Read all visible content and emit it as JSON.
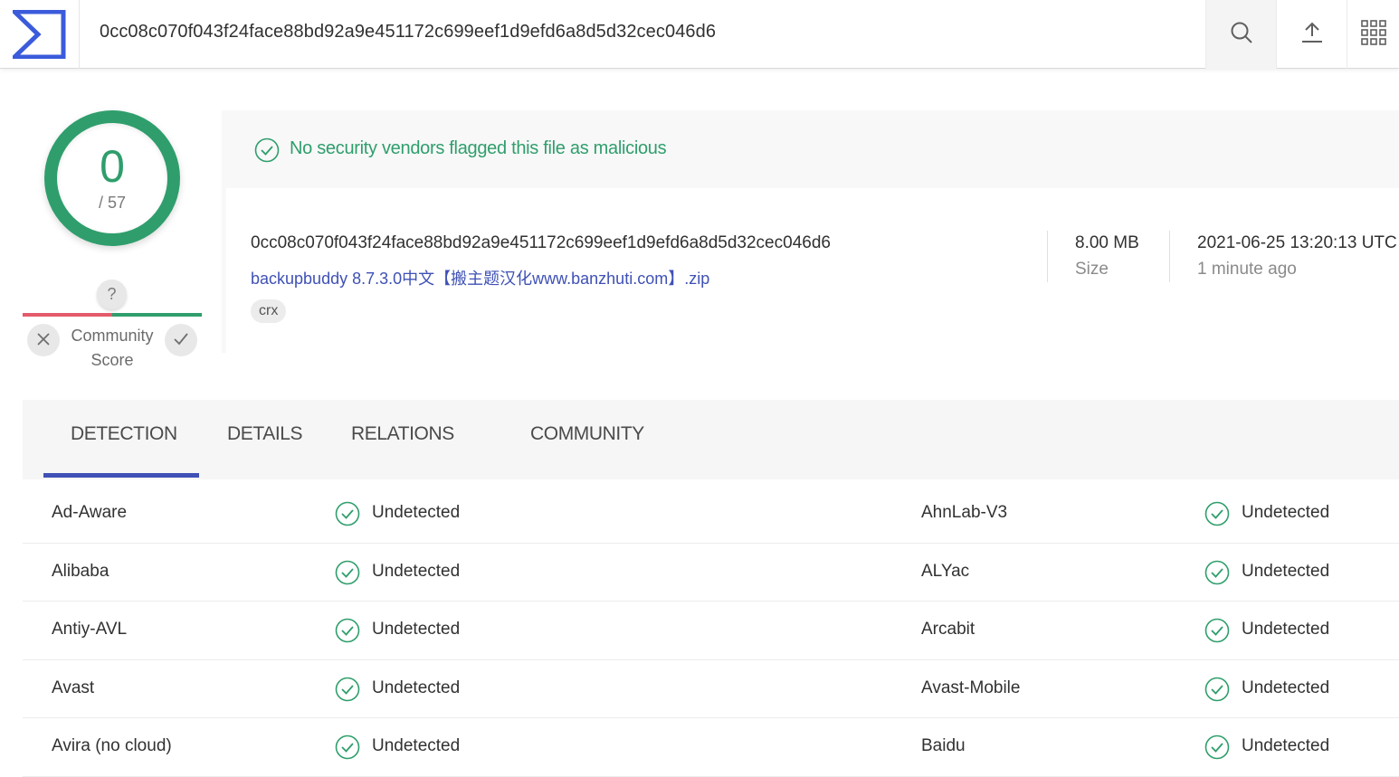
{
  "header": {
    "search_value": "0cc08c070f043f24face88bd92a9e451172c699eef1d9efd6a8d5d32cec046d6",
    "icons": [
      "logo-icon",
      "search-icon",
      "upload-icon",
      "apps-grid-icon"
    ]
  },
  "score": {
    "detections": "0",
    "total": "/ 57",
    "community_question": "?",
    "community_label": "Community Score",
    "community_line1": "Community",
    "community_line2": "Score"
  },
  "summary": {
    "banner": "No security vendors flagged this file as malicious",
    "hash": "0cc08c070f043f24face88bd92a9e451172c699eef1d9efd6a8d5d32cec046d6",
    "filename": "backupbuddy 8.7.3.0中文【搬主题汉化www.banzhuti.com】.zip",
    "tag": "crx",
    "size": "8.00 MB",
    "size_label": "Size",
    "date": "2021-06-25 13:20:13 UTC",
    "date_ago": "1 minute ago"
  },
  "tabs": [
    {
      "label": "DETECTION",
      "active": true
    },
    {
      "label": "DETAILS",
      "active": false
    },
    {
      "label": "RELATIONS",
      "active": false
    },
    {
      "label": "COMMUNITY",
      "active": false
    }
  ],
  "detections": [
    {
      "left_vendor": "Ad-Aware",
      "left_status": "Undetected",
      "right_vendor": "AhnLab-V3",
      "right_status": "Undetected"
    },
    {
      "left_vendor": "Alibaba",
      "left_status": "Undetected",
      "right_vendor": "ALYac",
      "right_status": "Undetected"
    },
    {
      "left_vendor": "Antiy-AVL",
      "left_status": "Undetected",
      "right_vendor": "Arcabit",
      "right_status": "Undetected"
    },
    {
      "left_vendor": "Avast",
      "left_status": "Undetected",
      "right_vendor": "Avast-Mobile",
      "right_status": "Undetected"
    },
    {
      "left_vendor": "Avira (no cloud)",
      "left_status": "Undetected",
      "right_vendor": "Baidu",
      "right_status": "Undetected"
    }
  ],
  "colors": {
    "accent": "#3f51b5",
    "clean": "#2f9e6c",
    "malicious": "#e35a6b"
  }
}
